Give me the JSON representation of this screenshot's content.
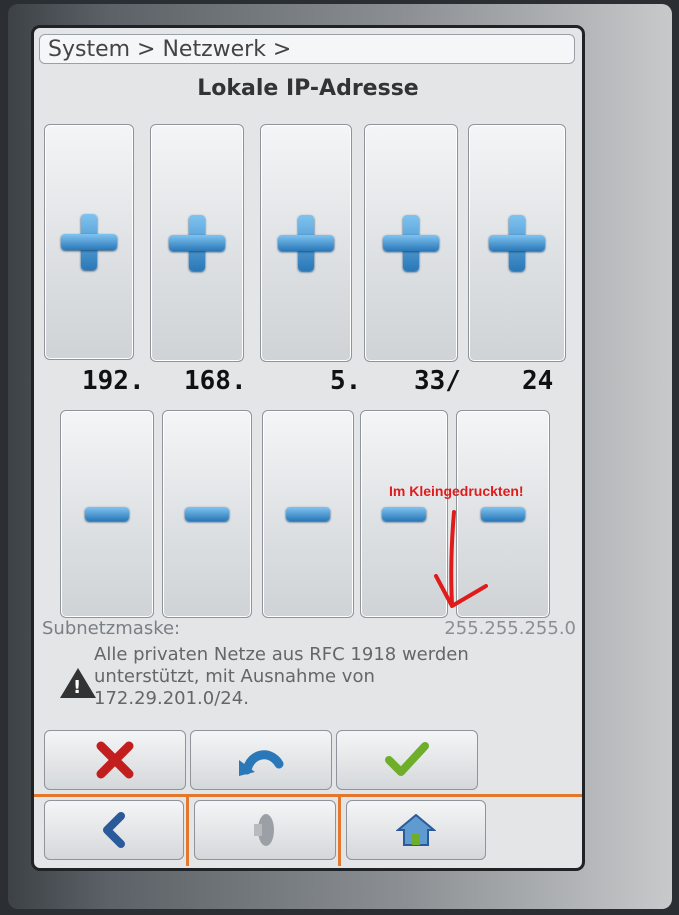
{
  "header": {
    "breadcrumb": "System > Netzwerk >",
    "title": "Lokale IP-Adresse"
  },
  "octets": [
    "192.",
    "168.",
    "5.",
    "33/",
    "24"
  ],
  "subnet": {
    "label": "Subnetzmaske:",
    "value": "255.255.255.0"
  },
  "info": {
    "text": "Alle privaten Netze aus RFC 1918 werden unterstützt, mit Ausnahme von 172.29.201.0/24."
  },
  "annotation": {
    "text": "Im Kleingedruckten!"
  },
  "colors": {
    "accent": "#e3782c",
    "button_blue": "#2a78b8",
    "cancel_red": "#c31e1e",
    "confirm_green": "#6fae2b"
  },
  "icons": {
    "increment": "plus-icon",
    "decrement": "minus-icon",
    "cancel": "red-x-icon",
    "undo": "undo-arrow-icon",
    "confirm": "green-check-icon",
    "back": "chevron-left-icon",
    "volume": "speaker-icon",
    "home": "home-icon"
  }
}
